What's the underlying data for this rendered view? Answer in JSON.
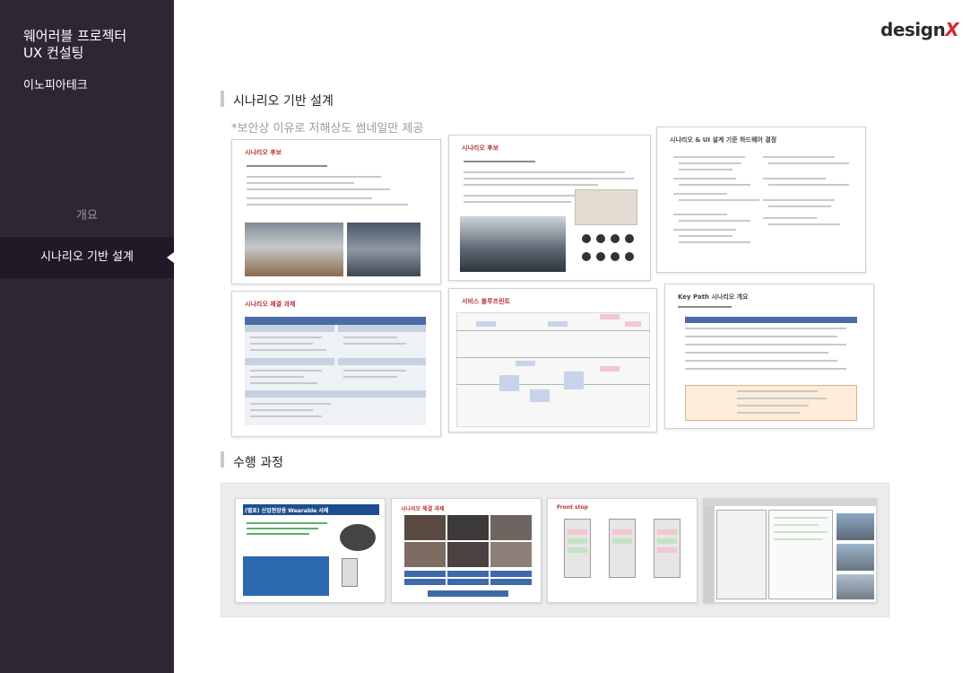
{
  "sidebar": {
    "title_line1": "웨어러블 프로젝터",
    "title_line2": "UX 컨설팅",
    "client": "이노피아테크",
    "nav": [
      {
        "label": "개요",
        "active": false
      },
      {
        "label": "시나리오 기반 설계",
        "active": true
      }
    ]
  },
  "logo": {
    "text_main": "design",
    "text_accent": "X"
  },
  "section1": {
    "title": "시나리오 기반 설계",
    "note": "*보안상 이유로 저해상도 썸네일만 제공",
    "thumbs": [
      {
        "title": "시나리오 후보"
      },
      {
        "title": "시나리오 후보"
      },
      {
        "title": "시나리오 & UI 설계 기준 하드웨어 결정"
      },
      {
        "title": "시나리오 체결 과제"
      },
      {
        "title": "서비스 블루프린트"
      },
      {
        "title": "Key Path 시나리오 개요"
      }
    ]
  },
  "section2": {
    "title": "수행 과정",
    "thumbs": [
      {
        "title": "(별표) 산업현장용 Wearable 사례"
      },
      {
        "title": "시나리오 체결 과제"
      },
      {
        "title": "Front stop"
      },
      {
        "title": ""
      }
    ]
  },
  "colors": {
    "sidebar_bg": "#2d2635",
    "sidebar_active": "#1f1a26",
    "accent": "#b8343a",
    "logo_x": "#d6262e"
  }
}
